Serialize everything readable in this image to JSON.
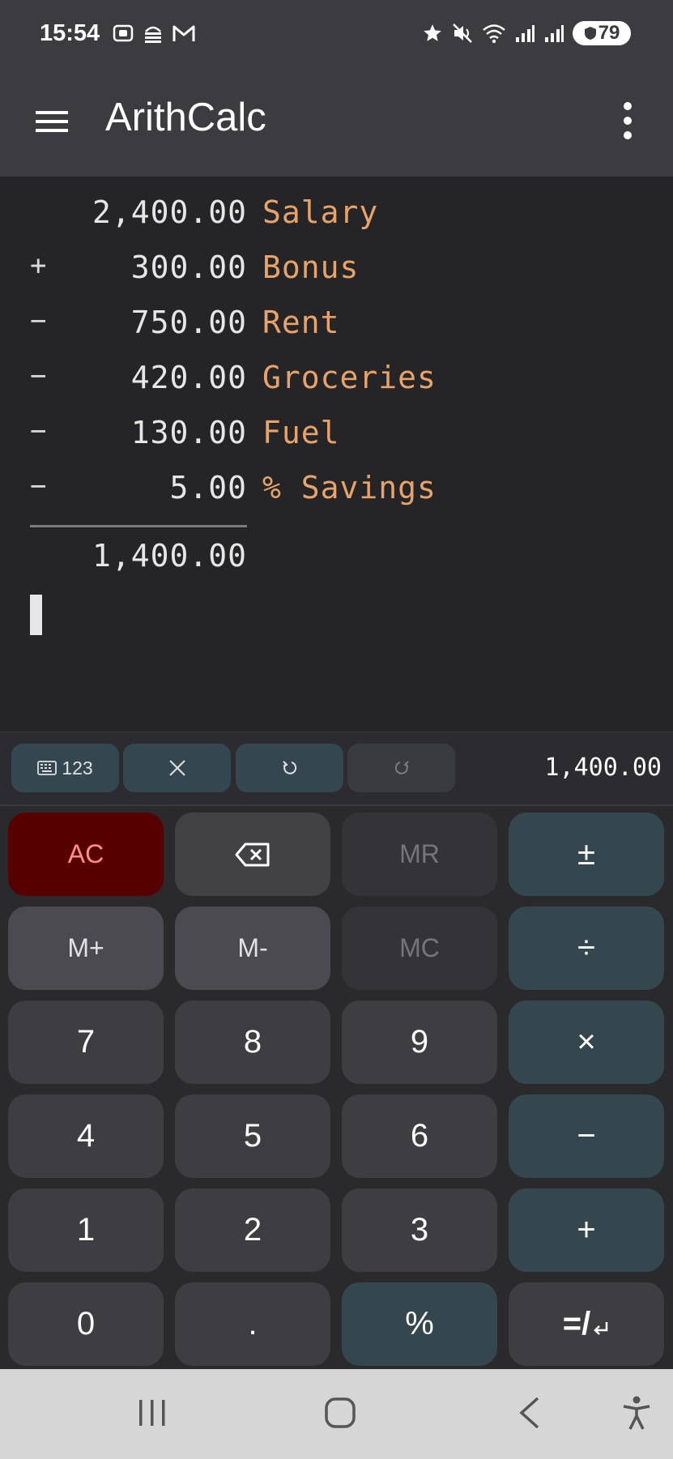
{
  "status_bar": {
    "time": "15:54",
    "left_icons": [
      "screenshot-icon",
      "cloud-sync-icon",
      "gmail-icon"
    ],
    "right_icons": [
      "star-icon",
      "mute-icon",
      "wifi-icon",
      "signal-icon",
      "signal-icon-2"
    ],
    "battery": "79"
  },
  "app_bar": {
    "title": "ArithCalc"
  },
  "tape": {
    "rows": [
      {
        "op": "",
        "value": "2,400.00",
        "label": "Salary"
      },
      {
        "op": "+",
        "value": "300.00",
        "label": "Bonus"
      },
      {
        "op": "−",
        "value": "750.00",
        "label": "Rent"
      },
      {
        "op": "−",
        "value": "420.00",
        "label": "Groceries"
      },
      {
        "op": "−",
        "value": "130.00",
        "label": "Fuel"
      },
      {
        "op": "−",
        "value": "5.00",
        "label": "% Savings"
      }
    ],
    "total": "1,400.00"
  },
  "toolbar": {
    "keyboard_label": "123",
    "display_value": "1,400.00"
  },
  "keypad": {
    "ac": "AC",
    "mr": "MR",
    "plus_minus": "±",
    "m_plus": "M+",
    "m_minus": "M-",
    "mc": "MC",
    "divide": "÷",
    "seven": "7",
    "eight": "8",
    "nine": "9",
    "multiply": "×",
    "four": "4",
    "five": "5",
    "six": "6",
    "minus": "−",
    "one": "1",
    "two": "2",
    "three": "3",
    "plus": "+",
    "zero": "0",
    "dot": ".",
    "percent": "%",
    "equals": "=/"
  },
  "colors": {
    "background": "#252528",
    "label_accent": "#e8a36a",
    "ac_key": "#560000",
    "operator_key": "#34474f"
  }
}
